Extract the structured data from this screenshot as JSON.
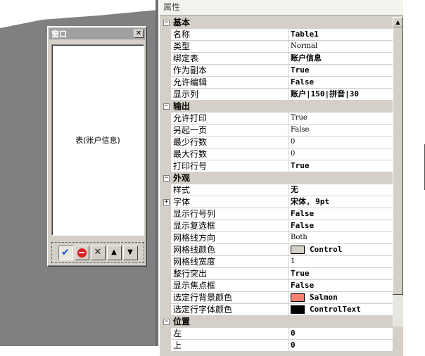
{
  "form_window": {
    "title": "窗口",
    "close_glyph": "✕",
    "table_text": "表(账户信息)",
    "toolbar": {
      "confirm_glyph": "✔",
      "delete_glyph": "✕",
      "up_glyph": "▲",
      "down_glyph": "▼"
    }
  },
  "property_panel": {
    "header": "属性",
    "categories": [
      {
        "name": "基本",
        "expander": "−",
        "rows": [
          {
            "name": "名称",
            "value": "Table1",
            "style": "bold"
          },
          {
            "name": "类型",
            "value": "Normal",
            "style": "mono"
          },
          {
            "name": "绑定表",
            "value": "账户信息",
            "style": "bold"
          },
          {
            "name": "作为副本",
            "value": "True",
            "style": "bold"
          },
          {
            "name": "允许编辑",
            "value": "False",
            "style": "bold"
          },
          {
            "name": "显示列",
            "value": "账户|150|拼音|30",
            "style": "bold"
          }
        ]
      },
      {
        "name": "输出",
        "expander": "−",
        "rows": [
          {
            "name": "允许打印",
            "value": "True",
            "style": "mono"
          },
          {
            "name": "另起一页",
            "value": "False",
            "style": "mono"
          },
          {
            "name": "最少行数",
            "value": "0",
            "style": "mono"
          },
          {
            "name": "最大行数",
            "value": "0",
            "style": "mono"
          },
          {
            "name": "打印行号",
            "value": "True",
            "style": "bold"
          }
        ]
      },
      {
        "name": "外观",
        "expander": "−",
        "rows": [
          {
            "name": "样式",
            "value": "无",
            "style": "bold"
          },
          {
            "name": "字体",
            "value": "宋体, 9pt",
            "style": "bold",
            "expander": "+"
          },
          {
            "name": "显示行号列",
            "value": "False",
            "style": "bold"
          },
          {
            "name": "显示复选框",
            "value": "False",
            "style": "bold"
          },
          {
            "name": "网格线方向",
            "value": "Both",
            "style": "mono"
          },
          {
            "name": "网格线颜色",
            "value": "Control",
            "style": "bold",
            "swatch": "#d4d0c8"
          },
          {
            "name": "网格线宽度",
            "value": "1",
            "style": "mono"
          },
          {
            "name": "整行突出",
            "value": "True",
            "style": "bold"
          },
          {
            "name": "显示焦点框",
            "value": "False",
            "style": "bold"
          },
          {
            "name": "选定行背景颜色",
            "value": "Salmon",
            "style": "bold",
            "swatch": "#fa8072"
          },
          {
            "name": "选定行字体颜色",
            "value": "ControlText",
            "style": "bold",
            "swatch": "#000000"
          }
        ]
      },
      {
        "name": "位置",
        "expander": "−",
        "rows": [
          {
            "name": "左",
            "value": "0",
            "style": "bold"
          },
          {
            "name": "上",
            "value": "0",
            "style": "bold"
          }
        ]
      }
    ]
  },
  "scrollbar": {
    "up_glyph": "▲"
  }
}
